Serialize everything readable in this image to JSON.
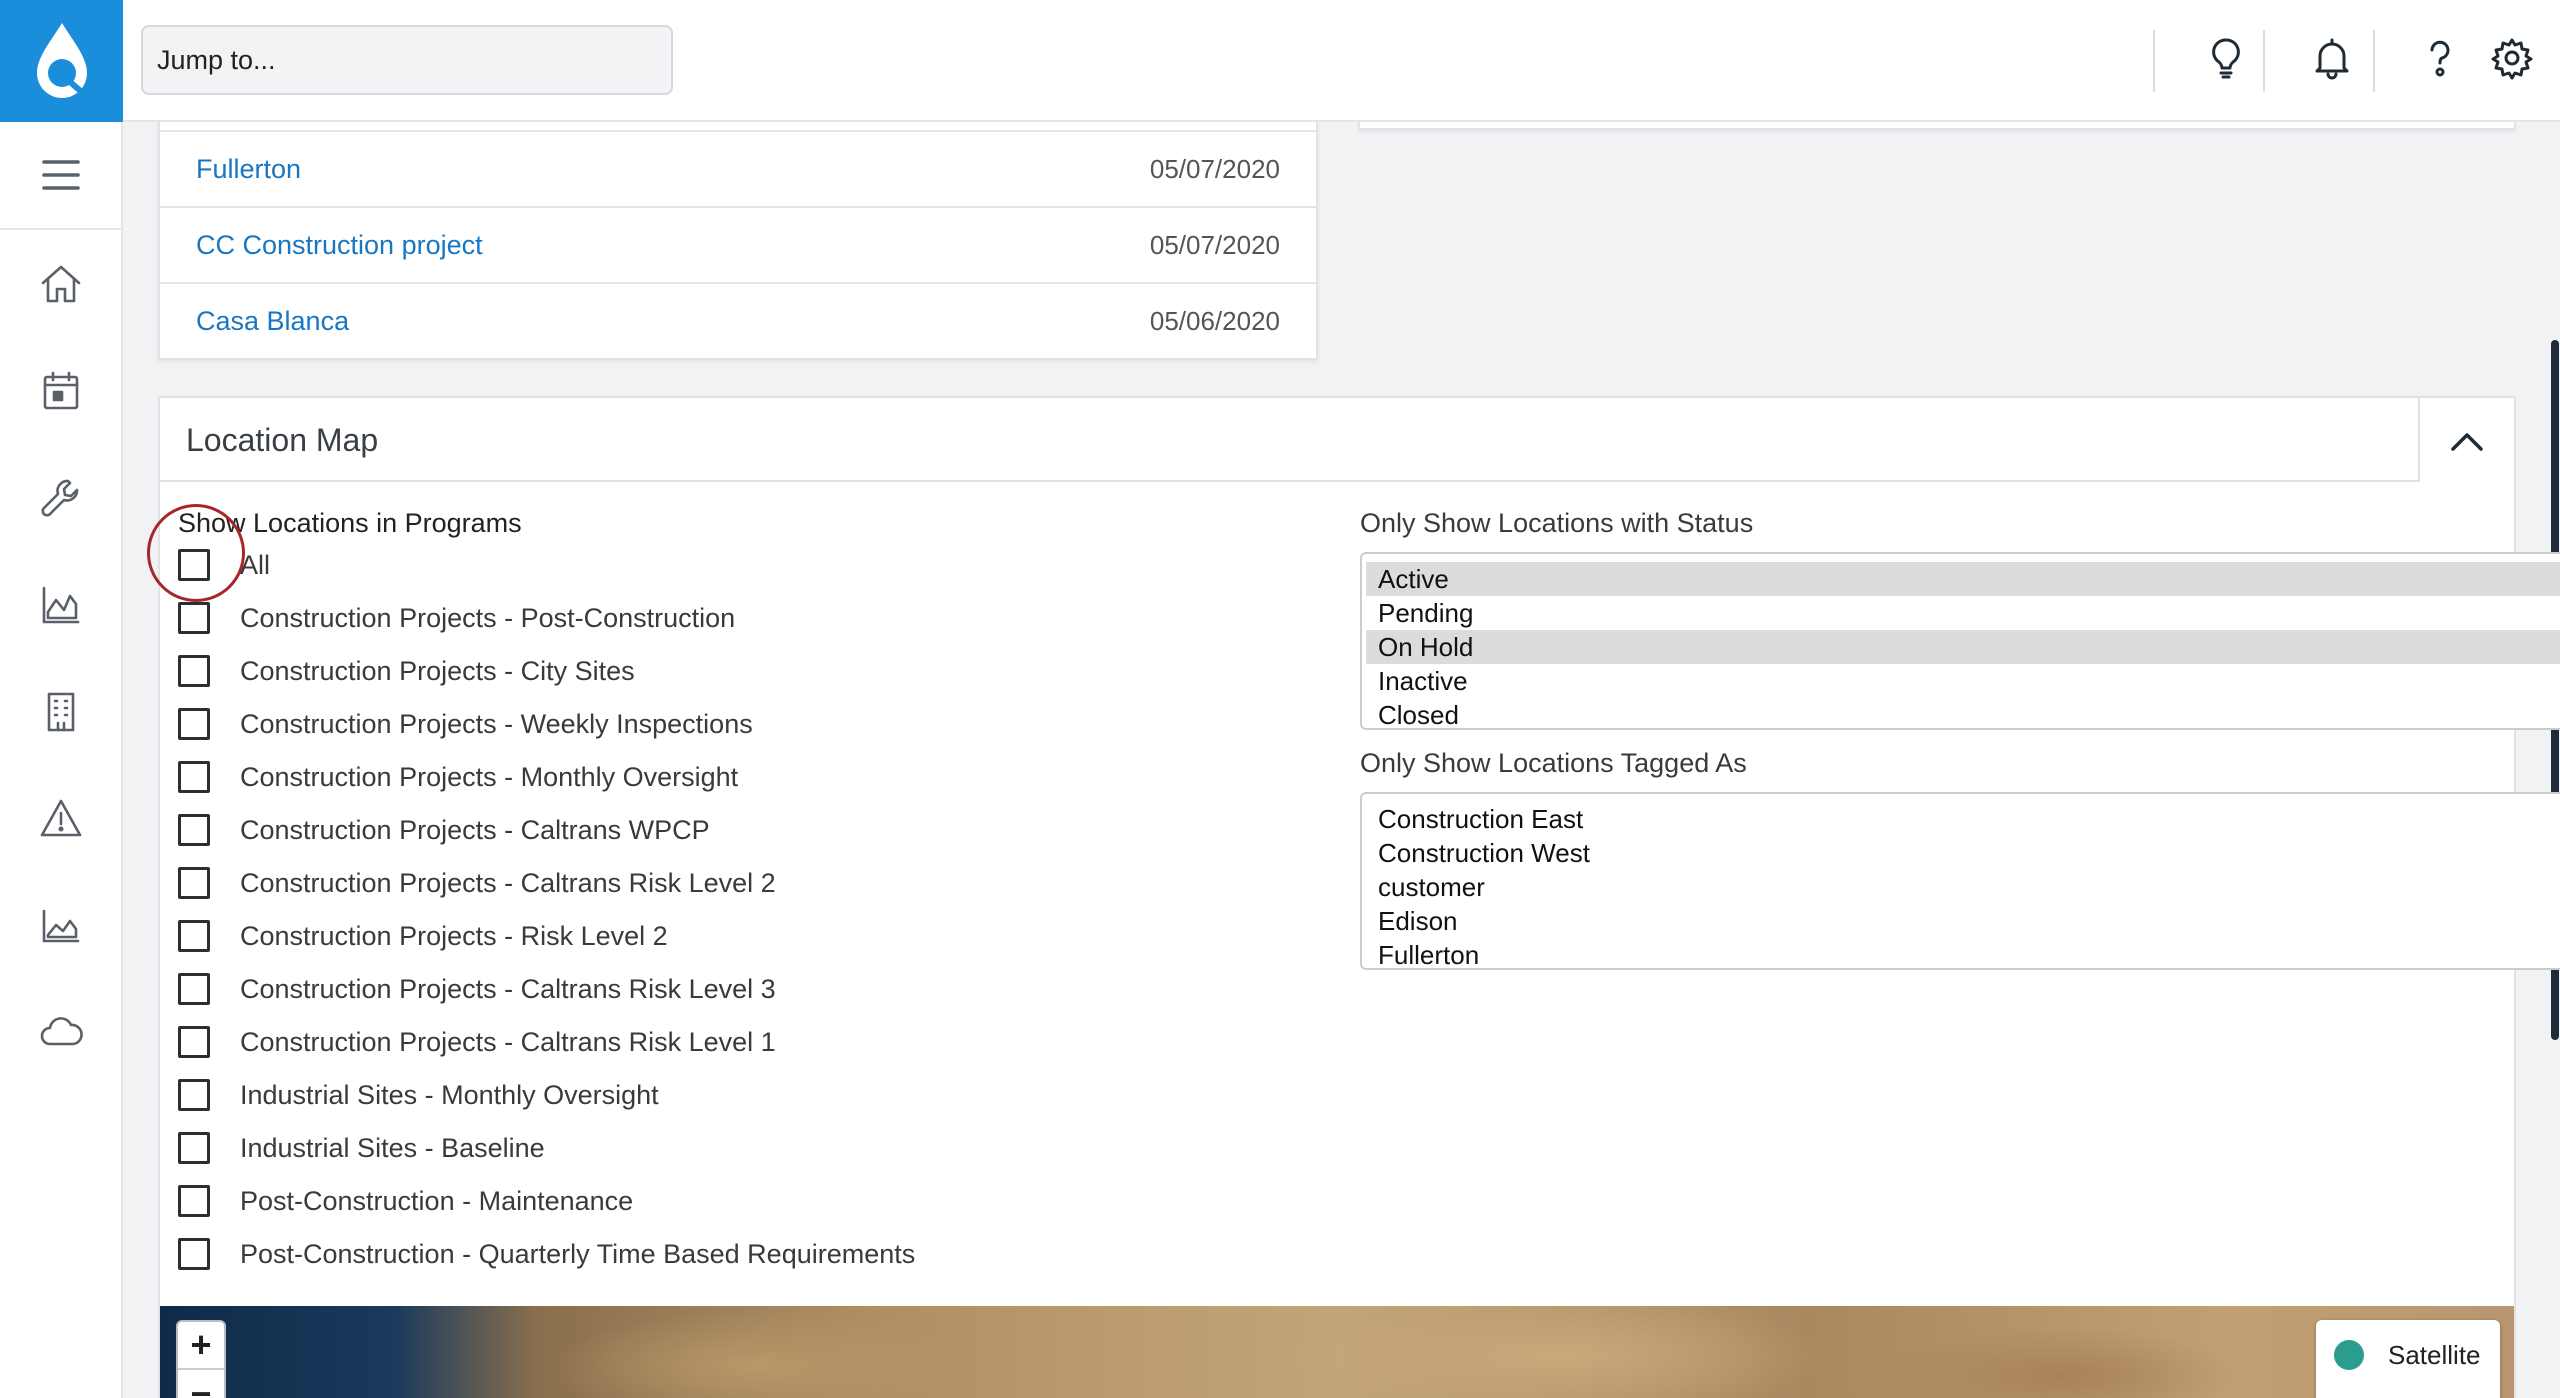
{
  "topbar": {
    "jump_placeholder": "Jump to...",
    "icons": [
      "lightbulb-icon",
      "bell-icon",
      "help-icon",
      "gear-icon",
      "logout-icon"
    ]
  },
  "sidebar": {
    "items": [
      "home-icon",
      "calendar-icon",
      "wrench-icon",
      "chart-icon",
      "building-icon",
      "warning-icon",
      "area-chart-icon",
      "cloud-icon"
    ]
  },
  "recent": {
    "rows": [
      {
        "name": "Fullerton",
        "date": "05/07/2020"
      },
      {
        "name": "CC Construction project",
        "date": "05/07/2020"
      },
      {
        "name": "Casa Blanca",
        "date": "05/06/2020"
      }
    ]
  },
  "location_map": {
    "title": "Location Map",
    "programs_label": "Show Locations in Programs",
    "programs": [
      "All",
      "Construction Projects - Post-Construction",
      "Construction Projects - City Sites",
      "Construction Projects - Weekly Inspections",
      "Construction Projects - Monthly Oversight",
      "Construction Projects - Caltrans WPCP",
      "Construction Projects - Caltrans Risk Level 2",
      "Construction Projects - Risk Level 2",
      "Construction Projects - Caltrans Risk Level 3",
      "Construction Projects - Caltrans Risk Level 1",
      "Industrial Sites - Monthly Oversight",
      "Industrial Sites - Baseline",
      "Post-Construction - Maintenance",
      "Post-Construction - Quarterly Time Based Requirements"
    ],
    "status_label": "Only Show Locations with Status",
    "statuses": [
      "Active",
      "Pending",
      "On Hold",
      "Inactive",
      "Closed"
    ],
    "tags_label": "Only Show Locations Tagged As",
    "tags": [
      "Construction East",
      "Construction West",
      "customer",
      "Edison",
      "Fullerton"
    ],
    "map": {
      "zoom_in": "+",
      "zoom_out": "−",
      "layer": "Satellite"
    }
  },
  "colors": {
    "brand": "#1a8ddb",
    "link": "#1976c2",
    "highlight_ring": "#a8262a"
  }
}
